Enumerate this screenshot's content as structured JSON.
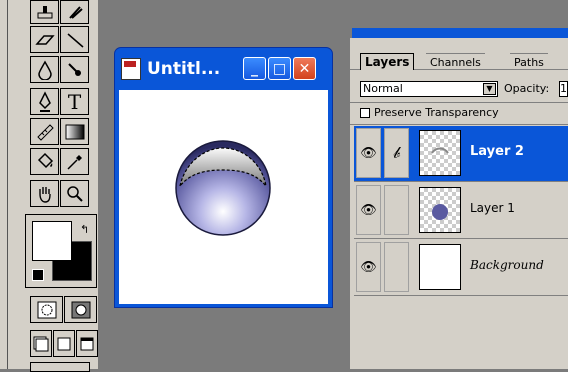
{
  "doc_window": {
    "title": "Untitl...",
    "buttons": {
      "minimize": "_",
      "maximize": "□",
      "close": "✕"
    }
  },
  "palette": {
    "tabs": [
      "Layers",
      "Channels",
      "Paths"
    ],
    "active_tab": "Layers",
    "blend_mode": "Normal",
    "opacity_label": "Opacity:",
    "opacity_value": "1",
    "preserve_transparency": "Preserve Transparency",
    "layers": [
      {
        "name": "Layer 2",
        "selected": true
      },
      {
        "name": "Layer 1",
        "selected": false
      },
      {
        "name": "Background",
        "selected": false
      }
    ]
  },
  "toolbox": {
    "icons": [
      "rubber-stamp-icon",
      "smudge-icon",
      "eraser-icon",
      "line-icon",
      "blur-icon",
      "sharpen-icon",
      "pen-icon",
      "type-icon",
      "measure-icon",
      "gradient-icon",
      "paint-bucket-icon",
      "eyedropper-icon",
      "hand-icon",
      "zoom-icon"
    ]
  },
  "colors": {
    "selection_blue": "#0a56d8",
    "panel_gray": "#d4d0c8",
    "workspace_gray": "#7b7b7b"
  }
}
